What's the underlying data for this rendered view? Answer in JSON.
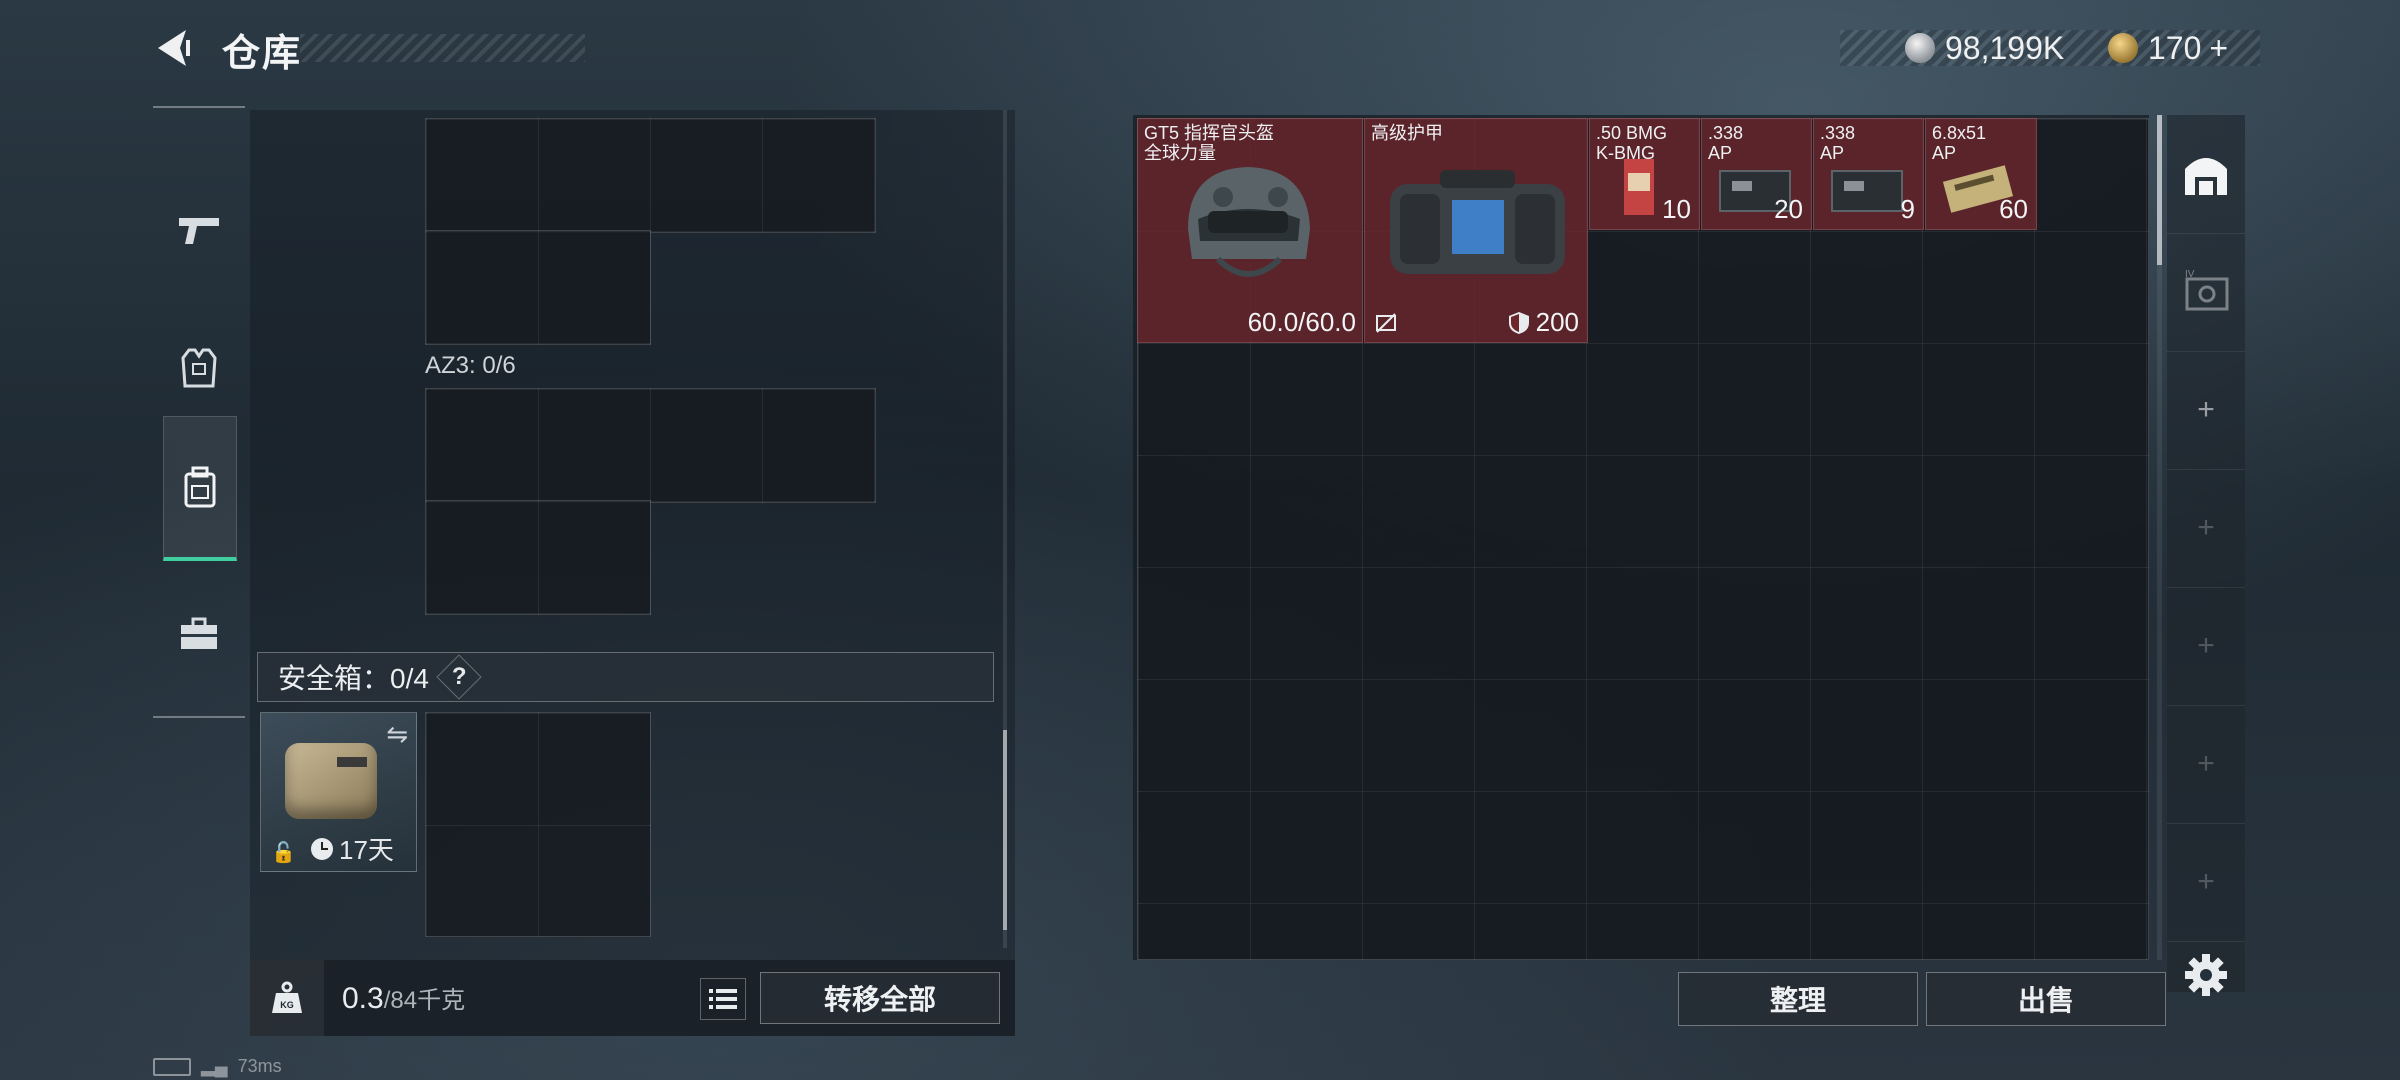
{
  "header": {
    "title": "仓库",
    "currencies": [
      {
        "icon": "silver-coin-icon",
        "value": "98,199K"
      },
      {
        "icon": "gold-coin-icon",
        "value": "170",
        "suffix": "+"
      }
    ]
  },
  "left_tabs": [
    {
      "name": "weapons",
      "icon": "pistol-icon"
    },
    {
      "name": "armor",
      "icon": "vest-icon"
    },
    {
      "name": "backpack",
      "icon": "backpack-icon",
      "active": true
    },
    {
      "name": "toolbox",
      "icon": "briefcase-icon"
    }
  ],
  "left_panel": {
    "az_label": "AZ3: 0/6",
    "safebox": {
      "label": "安全箱：0/4",
      "help": "?",
      "timer": "17天"
    }
  },
  "left_bottom": {
    "weight_value": "0.3",
    "weight_max": "/84千克",
    "transfer_all": "转移全部"
  },
  "stash": {
    "items": [
      {
        "name": "GT5 指挥官头盔\n全球力量",
        "durability": "60.0/60.0",
        "type": "helmet"
      },
      {
        "name": "高级护甲",
        "stat": "200",
        "type": "armor"
      },
      {
        "name": ".50 BMG\nK-BMG",
        "count": "10",
        "type": "ammo",
        "color": "#b33a3a"
      },
      {
        "name": ".338\nAP",
        "count": "20",
        "type": "ammo",
        "color": "#2a2f33"
      },
      {
        "name": ".338\nAP",
        "count": "9",
        "type": "ammo",
        "color": "#2a2f33"
      },
      {
        "name": "6.8x51\nAP",
        "count": "60",
        "type": "ammo",
        "color": "#c4b27a"
      }
    ],
    "sort_label": "整理",
    "sell_label": "出售"
  },
  "status": {
    "ping": "73ms"
  },
  "colors": {
    "accent": "#3fcfa0",
    "item_bg": "#6e262d"
  }
}
